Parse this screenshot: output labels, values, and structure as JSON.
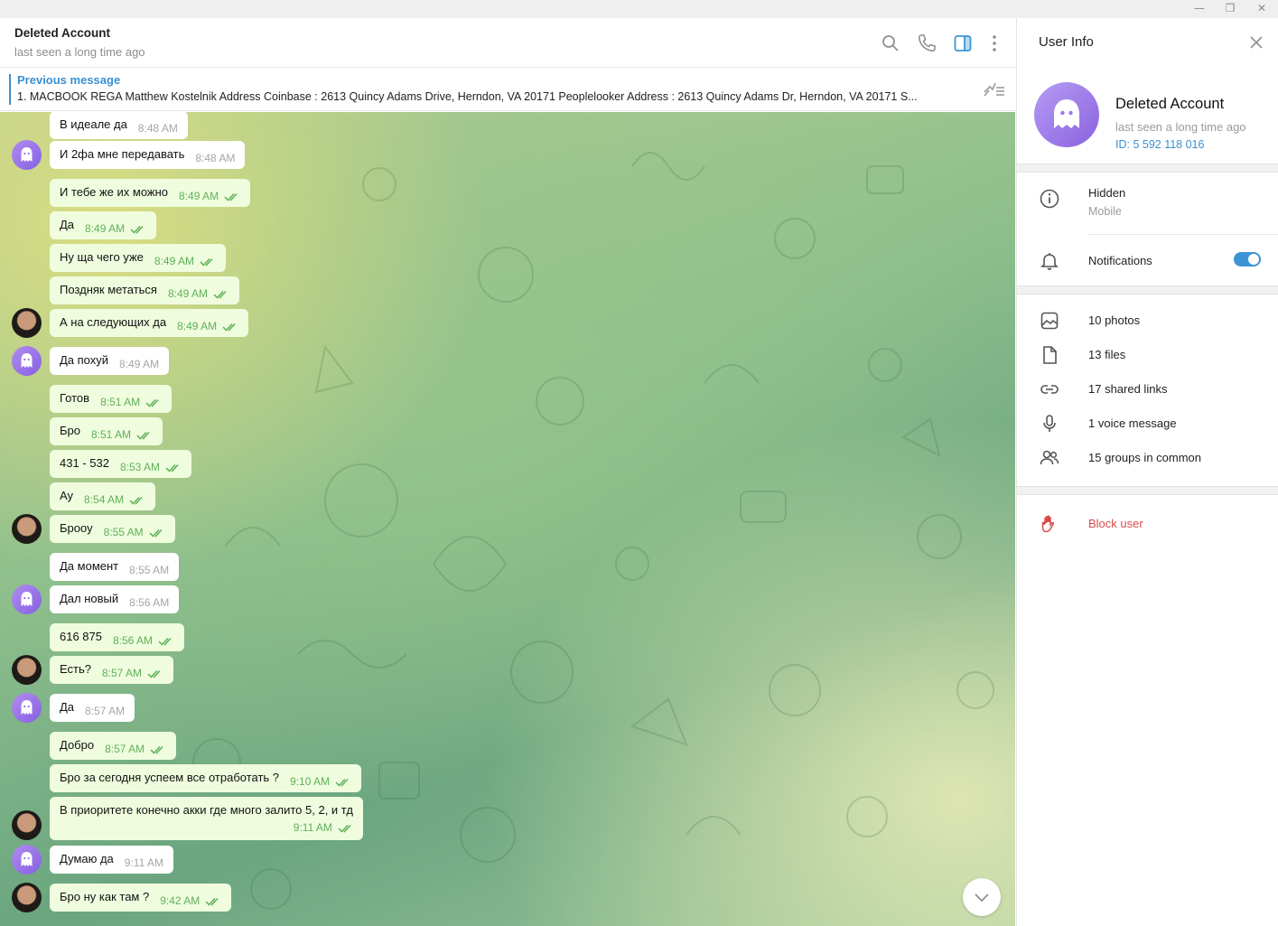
{
  "window": {
    "minimize": "—",
    "restore": "❐",
    "close": "✕"
  },
  "header": {
    "name": "Deleted Account",
    "status": "last seen a long time ago",
    "icons": [
      "search-icon",
      "phone-icon",
      "sidebar-toggle-icon",
      "more-vert-icon"
    ]
  },
  "pinned": {
    "title": "Previous message",
    "text": "1. MACBOOK REGA  Matthew Kostelnik  Address Coinbase : 2613 Quincy Adams Drive, Herndon, VA 20171   Peoplelooker Address : 2613 Quincy Adams Dr, Herndon, VA 20171 S..."
  },
  "messages": [
    {
      "text": "В идеале да",
      "time": "8:48 AM",
      "dir": "in",
      "avatar": ""
    },
    {
      "text": "И 2фа мне передавать",
      "time": "8:48 AM",
      "dir": "in",
      "avatar": "ghost"
    },
    {
      "text": "И тебе же их можно",
      "time": "8:49 AM",
      "dir": "out",
      "avatar": ""
    },
    {
      "text": "Да",
      "time": "8:49 AM",
      "dir": "out",
      "avatar": ""
    },
    {
      "text": "Ну ща чего уже",
      "time": "8:49 AM",
      "dir": "out",
      "avatar": ""
    },
    {
      "text": "Поздняк метаться",
      "time": "8:49 AM",
      "dir": "out",
      "avatar": ""
    },
    {
      "text": "А на следующих да",
      "time": "8:49 AM",
      "dir": "out",
      "avatar": "photo"
    },
    {
      "text": "Да похуй",
      "time": "8:49 AM",
      "dir": "in",
      "avatar": "ghost"
    },
    {
      "text": "Готов",
      "time": "8:51 AM",
      "dir": "out",
      "avatar": ""
    },
    {
      "text": "Бро",
      "time": "8:51 AM",
      "dir": "out",
      "avatar": ""
    },
    {
      "text": "431 - 532",
      "time": "8:53 AM",
      "dir": "out",
      "avatar": ""
    },
    {
      "text": "Ау",
      "time": "8:54 AM",
      "dir": "out",
      "avatar": ""
    },
    {
      "text": "Брооу",
      "time": "8:55 AM",
      "dir": "out",
      "avatar": "photo"
    },
    {
      "text": "Да момент",
      "time": "8:55 AM",
      "dir": "in",
      "avatar": ""
    },
    {
      "text": "Дал новый",
      "time": "8:56 AM",
      "dir": "in",
      "avatar": "ghost"
    },
    {
      "text": "616 875",
      "time": "8:56 AM",
      "dir": "out",
      "avatar": ""
    },
    {
      "text": "Есть?",
      "time": "8:57 AM",
      "dir": "out",
      "avatar": "photo"
    },
    {
      "text": "Да",
      "time": "8:57 AM",
      "dir": "in",
      "avatar": "ghost"
    },
    {
      "text": "Добро",
      "time": "8:57 AM",
      "dir": "out",
      "avatar": ""
    },
    {
      "text": "Бро за сегодня успеем все отработать ?",
      "time": "9:10 AM",
      "dir": "out",
      "avatar": ""
    },
    {
      "text": "В приоритете конечно акки где много залито 5, 2, и тд",
      "time": "9:11 AM",
      "dir": "out",
      "avatar": "photo",
      "multi": true
    },
    {
      "text": "Думаю да",
      "time": "9:11 AM",
      "dir": "in",
      "avatar": "ghost"
    },
    {
      "text": "Бро ну как там ?",
      "time": "9:42 AM",
      "dir": "out",
      "avatar": "photo"
    }
  ],
  "user_info": {
    "title": "User Info",
    "name": "Deleted Account",
    "status": "last seen a long time ago",
    "id": "ID: 5 592 118 016",
    "phone_label": "Hidden",
    "phone_sub": "Mobile",
    "notifications_label": "Notifications",
    "notifications_on": true,
    "media": [
      {
        "icon": "photo-icon",
        "label": "10 photos"
      },
      {
        "icon": "file-icon",
        "label": "13 files"
      },
      {
        "icon": "link-icon",
        "label": "17 shared links"
      },
      {
        "icon": "microphone-icon",
        "label": "1 voice message"
      },
      {
        "icon": "groups-icon",
        "label": "15 groups in common"
      }
    ],
    "block_label": "Block user"
  }
}
